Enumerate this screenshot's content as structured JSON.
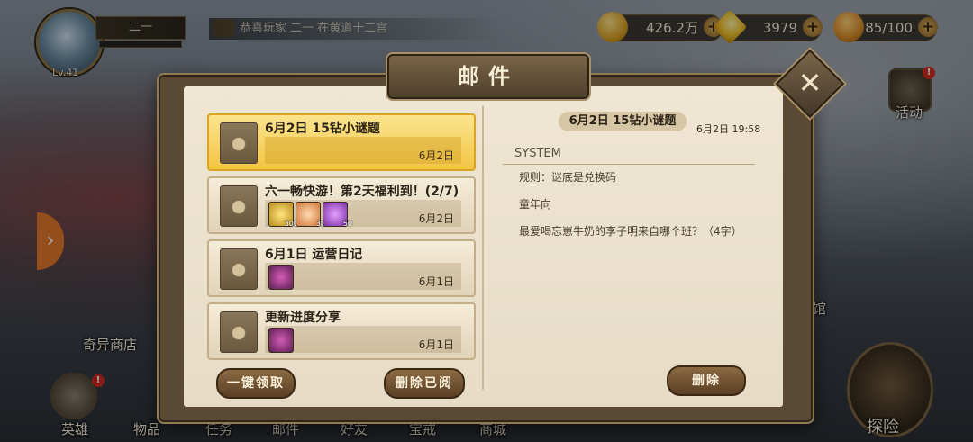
{
  "player": {
    "name": "二一",
    "level": "Lv.41"
  },
  "ticker": {
    "text": "恭喜玩家   二一   在黄道十二宫"
  },
  "resources": {
    "gold": "426.2万",
    "gems": "3979",
    "stamina": "85/100",
    "plus": "+"
  },
  "side": {
    "event_label": "活动",
    "shop_label": "奇异商店",
    "hall_label": "馆",
    "explore_label": "探险"
  },
  "nav": {
    "hero": "英雄",
    "items": "物品",
    "tasks": "任务",
    "mail": "邮件",
    "friends": "好友",
    "ring": "宝戒",
    "shop": "商城"
  },
  "panel": {
    "title": "邮件",
    "close": "✕",
    "claim_all": "一键领取",
    "delete_read": "删除已阅",
    "delete": "删除"
  },
  "mails": [
    {
      "subject": "6月2日 15钻小谜题",
      "date": "6月2日"
    },
    {
      "subject": "六一畅快游！第2天福利到！(2/7)",
      "date": "6月2日",
      "items": [
        {
          "count": "300"
        },
        {
          "count": "30"
        },
        {
          "count": "50"
        }
      ]
    },
    {
      "subject": "6月1日 运营日记",
      "date": "6月1日"
    },
    {
      "subject": "更新进度分享",
      "date": "6月1日"
    }
  ],
  "detail": {
    "title": "6月2日 15钻小谜题",
    "time": "6月2日 19:58",
    "sender": "SYSTEM",
    "lines": [
      "规则：谜底是兑换码",
      "童年向",
      "最爱喝忘崽牛奶的李子明来自哪个班？（4字）"
    ]
  },
  "colors": {
    "selected_mail": "#f2c544",
    "panel_paper": "#efe6d3",
    "accent_orange": "#e2782c"
  }
}
